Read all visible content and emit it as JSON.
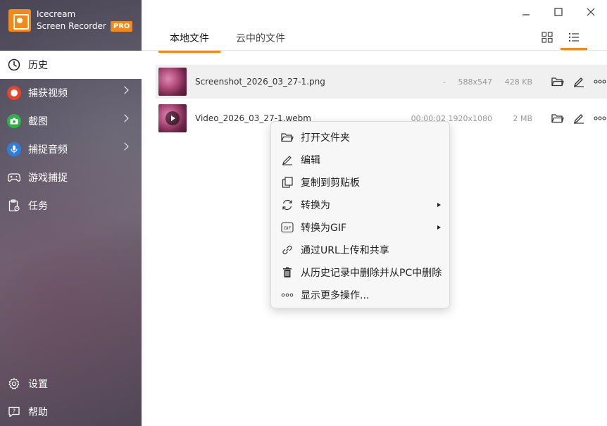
{
  "app": {
    "name_line1": "Icecream",
    "name_line2": "Screen Recorder",
    "badge": "PRO",
    "accent": "#f28a1a"
  },
  "sidebar": {
    "items": [
      {
        "label": "历史",
        "icon": "clock-icon",
        "active": true
      },
      {
        "label": "捕获视频",
        "icon": "record-icon",
        "submenu": true
      },
      {
        "label": "截图",
        "icon": "camera-icon",
        "submenu": true
      },
      {
        "label": "捕捉音频",
        "icon": "microphone-icon",
        "submenu": true
      },
      {
        "label": "游戏捕捉",
        "icon": "gamepad-icon"
      },
      {
        "label": "任务",
        "icon": "task-icon"
      }
    ],
    "bottom": [
      {
        "label": "设置",
        "icon": "gear-icon"
      },
      {
        "label": "帮助",
        "icon": "help-icon"
      }
    ]
  },
  "tabs": [
    {
      "label": "本地文件",
      "active": true
    },
    {
      "label": "云中的文件",
      "active": false
    }
  ],
  "files": [
    {
      "name": "Screenshot_2026_03_27-1.png",
      "duration": "-",
      "resolution": "588x547",
      "size": "428 KB",
      "type": "image"
    },
    {
      "name": "Video_2026_03_27-1.webm",
      "duration": "00:00:02",
      "resolution": "1920x1080",
      "size": "2 MB",
      "type": "video"
    }
  ],
  "context_menu": [
    {
      "label": "打开文件夹",
      "icon": "folder-icon"
    },
    {
      "label": "编辑",
      "icon": "pencil-icon"
    },
    {
      "label": "复制到剪贴板",
      "icon": "copy-icon"
    },
    {
      "label": "转换为",
      "icon": "convert-icon",
      "submenu": true
    },
    {
      "label": "转换为GIF",
      "icon": "gif-icon",
      "submenu": true
    },
    {
      "label": "通过URL上传和共享",
      "icon": "link-icon"
    },
    {
      "label": "从历史记录中删除并从PC中删除",
      "icon": "trash-icon"
    },
    {
      "label": "显示更多操作...",
      "icon": "more-icon"
    }
  ]
}
